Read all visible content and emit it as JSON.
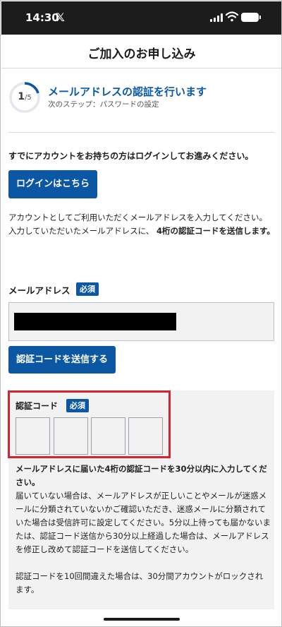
{
  "status_bar": {
    "time": "14:30",
    "app_icon": "x-icon"
  },
  "page": {
    "title": "ご加入のお申し込み"
  },
  "progress": {
    "current": "1",
    "total": "/5",
    "fraction": 0.2,
    "step_title": "メールアドレスの認証を行います",
    "next_step": "次のステップ：パスワードの設定"
  },
  "intro": {
    "text": "すでにアカウントをお持ちの方はログインしてお進みください。",
    "login_button": "ログインはこちら"
  },
  "description": {
    "line1": "アカウントとしてご利用いただくメールアドレスを入力してください。",
    "line2_prefix": "入力していただいたメールアドレスに、",
    "line2_bold": "4桁の認証コードを送信します。"
  },
  "email": {
    "label": "メールアドレス",
    "required_badge": "必須",
    "value": "",
    "send_button": "認証コードを送信する"
  },
  "code": {
    "label": "認証コード",
    "required_badge": "必須",
    "digits": [
      "",
      "",
      "",
      ""
    ],
    "note_bold": "メールアドレスに届いた4桁の認証コードを30分以内に入力してください。",
    "note_body": "届いていない場合は、メールアドレスが正しいことやメールが迷惑メールに分類されていないかご確認いただき、迷惑メールに分類されていた場合は受信許可に設定してください。5分以上待っても届かないまたは、認証コード送信から30分以上経過した場合は、メールアドレスを修正し改めて認証コードを送信してください。",
    "note_lock": "認証コードを10回間違えた場合は、30分間アカウントがロックされます。"
  },
  "colors": {
    "accent": "#0b57a4",
    "step_title": "#0b5aa6",
    "highlight": "#d6232e",
    "panel_bg": "#f2f2f2"
  }
}
